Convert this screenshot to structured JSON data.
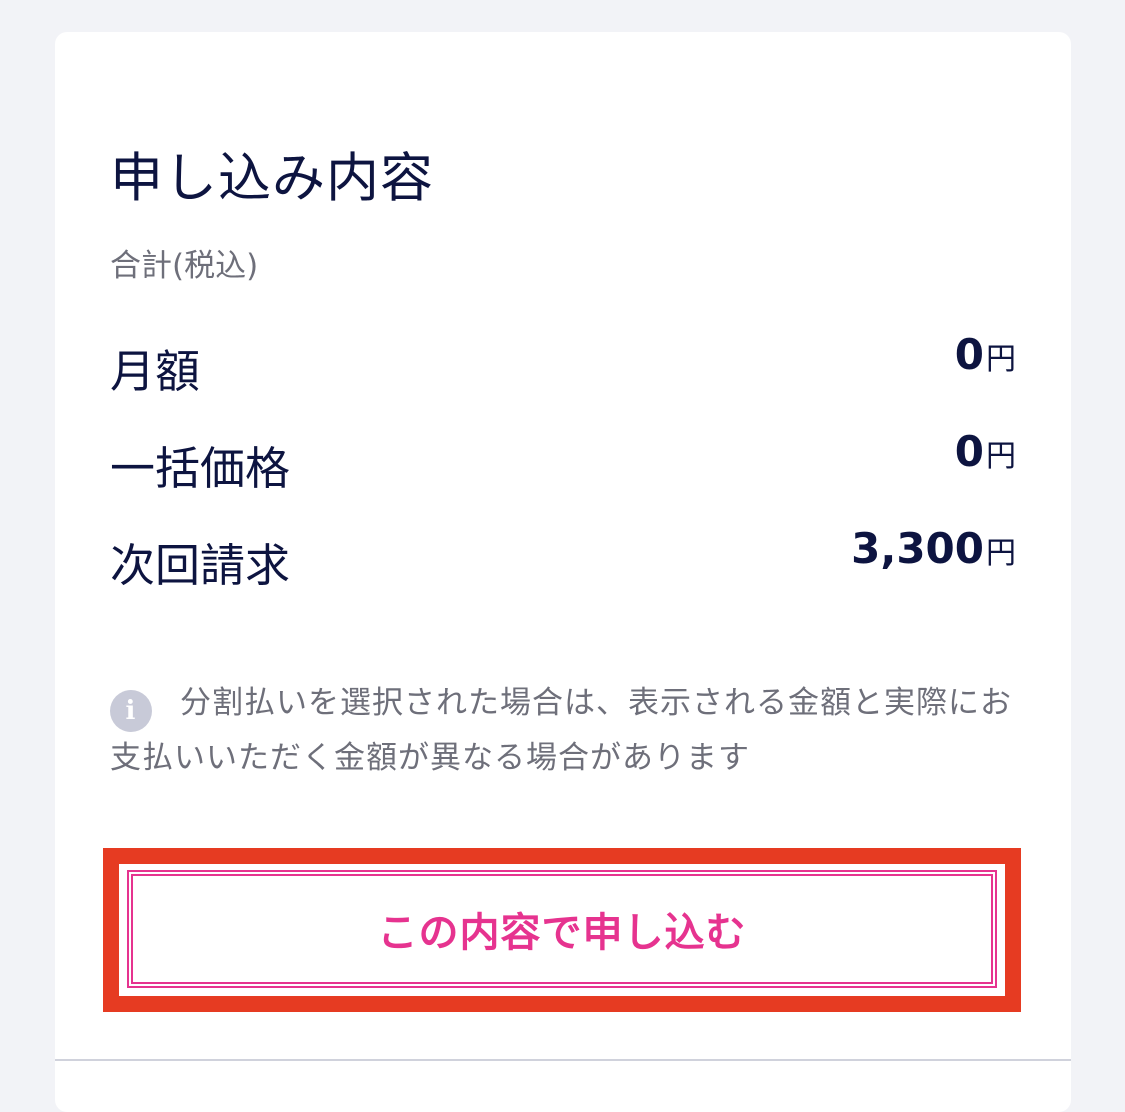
{
  "summary": {
    "title": "申し込み内容",
    "subtitle": "合計(税込)",
    "rows": [
      {
        "label": "月額",
        "amount": "0",
        "unit": "円"
      },
      {
        "label": "一括価格",
        "amount": "0",
        "unit": "円"
      },
      {
        "label": "次回請求",
        "amount": "3,300",
        "unit": "円"
      }
    ],
    "note": {
      "icon": "info-icon",
      "icon_glyph": "i",
      "text": "分割払いを選択された場合は、表示される金額と実際にお支払いいただく金額が異なる場合があります"
    },
    "submit_label": "この内容で申し込む"
  },
  "colors": {
    "background": "#f2f3f7",
    "card": "#ffffff",
    "text_primary": "#0d1440",
    "text_secondary": "#6e6f7a",
    "accent": "#e6338f",
    "highlight": "#e63b22"
  }
}
